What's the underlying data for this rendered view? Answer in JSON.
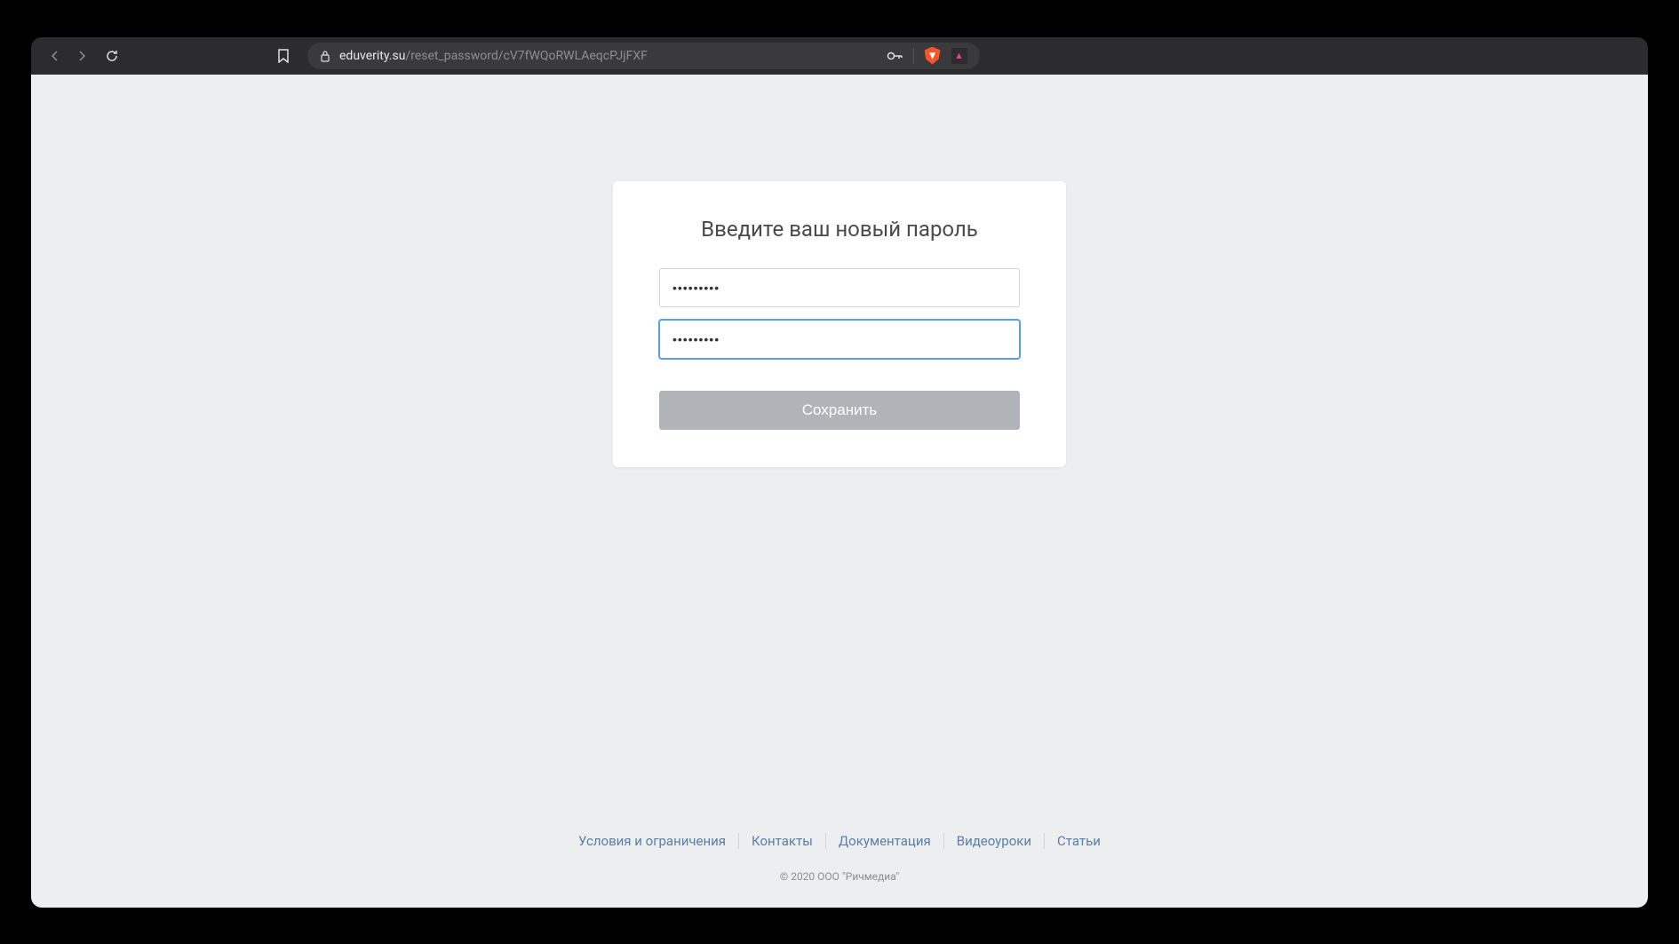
{
  "browser": {
    "url_domain": "eduverity.su",
    "url_path": "/reset_password/cV7fWQoRWLAeqcPJjFXF"
  },
  "card": {
    "title": "Введите ваш новый пароль",
    "password_value": "•••••••••",
    "password_confirm_value": "•••••••••",
    "save_button": "Сохранить"
  },
  "footer": {
    "links": [
      "Условия и ограничения",
      "Контакты",
      "Документация",
      "Видеоуроки",
      "Статьи"
    ],
    "copyright": "© 2020 ООО \"Ричмедиа\""
  }
}
